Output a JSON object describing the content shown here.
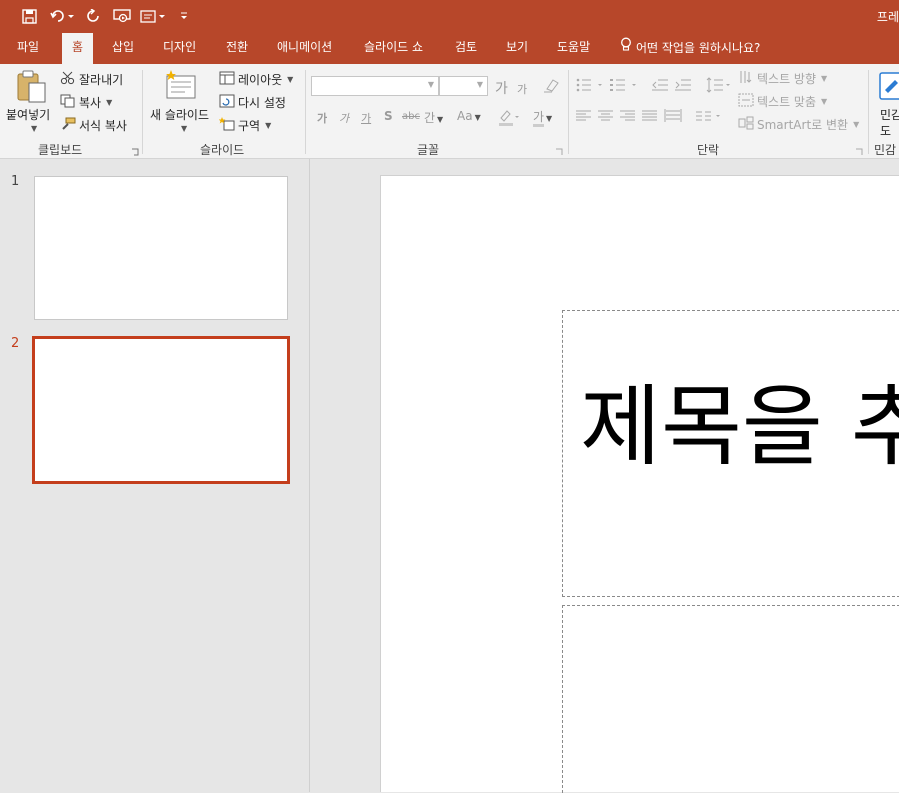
{
  "window": {
    "title_partial": "프레"
  },
  "quick_access": [
    "save-icon",
    "undo-icon",
    "redo-icon",
    "present-from-start-icon",
    "touch-mode-icon",
    "customize-icon"
  ],
  "tabs": [
    "파일",
    "홈",
    "삽입",
    "디자인",
    "전환",
    "애니메이션",
    "슬라이드 쇼",
    "검토",
    "보기",
    "도움말"
  ],
  "active_tab": "홈",
  "tell_me": "어떤 작업을 원하시나요?",
  "ribbon": {
    "clipboard": {
      "label": "클립보드",
      "paste": "붙여넣기",
      "cut": "잘라내기",
      "copy": "복사",
      "format_painter": "서식 복사"
    },
    "slides": {
      "label": "슬라이드",
      "new_slide": "새 슬라이드",
      "layout": "레이아웃",
      "reset": "다시 설정",
      "section": "구역"
    },
    "font": {
      "label": "글꼴",
      "font_name": "",
      "font_size": "",
      "grow": "가",
      "shrink": "가",
      "bold": "가",
      "italic": "가",
      "underline": "가",
      "shadow": "S",
      "strike": "abc",
      "spacing": "간",
      "case": "Aa",
      "color": "가"
    },
    "paragraph": {
      "label": "단락",
      "text_direction": "텍스트 방향",
      "align_text": "텍스트 맞춤",
      "smartart": "SmartArt로 변환"
    },
    "partial": {
      "label": "민감",
      "button_line1": "민감",
      "button_line2": "도"
    }
  },
  "thumbnails": [
    {
      "number": "1",
      "selected": false
    },
    {
      "number": "2",
      "selected": true
    }
  ],
  "slide": {
    "title_text": "제목을 추"
  },
  "colors": {
    "brand": "#b7472a",
    "selection": "#c43e1c"
  }
}
